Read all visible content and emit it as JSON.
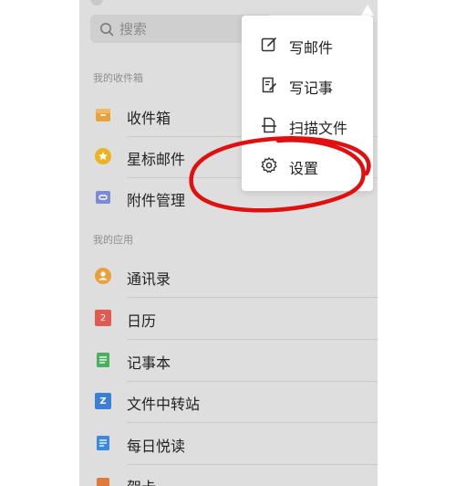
{
  "search": {
    "placeholder": "搜索"
  },
  "inbox_section": {
    "title": "我的收件箱",
    "items": [
      {
        "label": "收件箱",
        "icon": "inbox-tray-icon",
        "color": "#e8a13c"
      },
      {
        "label": "星标邮件",
        "icon": "star-icon",
        "color": "#e8b420"
      },
      {
        "label": "附件管理",
        "icon": "attachment-icon",
        "color": "#7c8bd6"
      }
    ]
  },
  "apps_section": {
    "title": "我的应用",
    "items": [
      {
        "label": "通讯录",
        "icon": "contacts-icon",
        "color": "#e8a13c"
      },
      {
        "label": "日历",
        "icon": "calendar-icon",
        "color": "#e05a52",
        "glyph": "2"
      },
      {
        "label": "记事本",
        "icon": "notes-icon",
        "color": "#4caf60"
      },
      {
        "label": "文件中转站",
        "icon": "file-transfer-icon",
        "color": "#3b7fd6",
        "glyph": "Z"
      },
      {
        "label": "每日悦读",
        "icon": "daily-reading-icon",
        "color": "#3b8ae0"
      },
      {
        "label": "贺卡",
        "icon": "greeting-card-icon",
        "color": "#e07a3a"
      }
    ]
  },
  "menu": {
    "items": [
      {
        "label": "写邮件",
        "icon": "compose-icon"
      },
      {
        "label": "写记事",
        "icon": "write-note-icon"
      },
      {
        "label": "扫描文件",
        "icon": "scan-document-icon"
      },
      {
        "label": "设置",
        "icon": "gear-icon"
      }
    ]
  },
  "annotation": {
    "color": "#e01010"
  }
}
